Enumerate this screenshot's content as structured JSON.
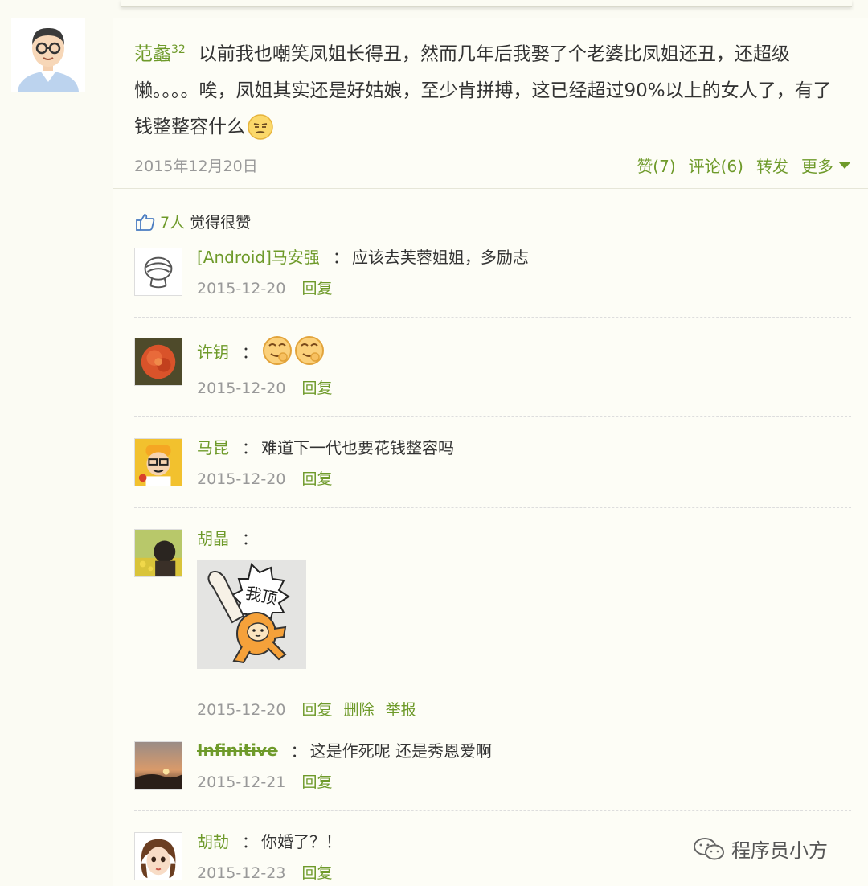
{
  "post": {
    "author": "范蠡",
    "level": "32",
    "text": "以前我也嘲笑凤姐长得丑，然而几年后我娶了个老婆比凤姐还丑，还超级懒。。。。唉，凤姐其实还是好姑娘，至少肯拼搏，这已经超过90%以上的女人了，有了钱整整容什么",
    "date": "2015年12月20日",
    "actions": {
      "like": "赞(7)",
      "comment": "评论(6)",
      "forward": "转发",
      "more": "更多"
    }
  },
  "likes": {
    "count": "7人",
    "suffix": "觉得很赞"
  },
  "comments": [
    {
      "name": "[Android]马安强",
      "text": "应该去芙蓉姐姐，多励志",
      "date": "2015-12-20",
      "reply": "回复"
    },
    {
      "name": "许钥",
      "text": "",
      "date": "2015-12-20",
      "reply": "回复"
    },
    {
      "name": "马昆",
      "text": "难道下一代也要花钱整容吗",
      "date": "2015-12-20",
      "reply": "回复"
    },
    {
      "name": "胡晶",
      "text": "",
      "date": "2015-12-20",
      "reply": "回复",
      "delete": "删除",
      "report": "举报",
      "sticker_text": "我顶"
    },
    {
      "name": "Infinitive",
      "text": "这是作死呢 还是秀恩爱啊",
      "date": "2015-12-21",
      "reply": "回复"
    },
    {
      "name": "胡劼",
      "text": "你婚了？！",
      "date": "2015-12-23",
      "reply": "回复"
    }
  ],
  "watermark": "程序员小方",
  "colors": {
    "link": "#6e9a2a",
    "meta": "#999999",
    "background": "#fbfbf3"
  }
}
